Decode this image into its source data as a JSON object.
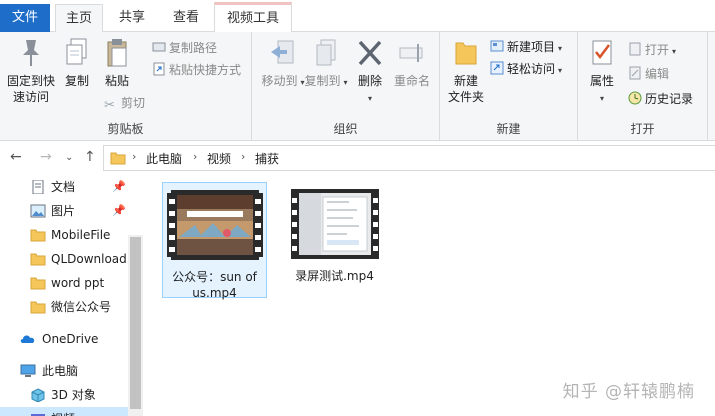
{
  "tabs": {
    "file": "文件",
    "home": "主页",
    "share": "共享",
    "view": "查看",
    "video_tools": "视频工具"
  },
  "ribbon": {
    "clipboard": {
      "label": "剪贴板",
      "pin_quick_access_1": "固定到快",
      "pin_quick_access_2": "速访问",
      "copy": "复制",
      "paste": "粘贴",
      "copy_path": "复制路径",
      "paste_shortcut": "粘贴快捷方式",
      "cut": "剪切"
    },
    "organize": {
      "label": "组织",
      "move_to": "移动到",
      "copy_to": "复制到",
      "delete": "删除",
      "rename": "重命名"
    },
    "new": {
      "label": "新建",
      "new_folder_1": "新建",
      "new_folder_2": "文件夹",
      "new_item": "新建项目",
      "easy_access": "轻松访问"
    },
    "open": {
      "label": "打开",
      "properties": "属性",
      "open": "打开",
      "edit": "编辑",
      "history": "历史记录"
    }
  },
  "breadcrumb": [
    "此电脑",
    "视频",
    "捕获"
  ],
  "sidebar": {
    "items": [
      {
        "label": "文档",
        "icon": "document-icon",
        "pinned": true
      },
      {
        "label": "图片",
        "icon": "picture-icon",
        "pinned": true
      },
      {
        "label": "MobileFile",
        "icon": "folder-icon"
      },
      {
        "label": "QLDownload",
        "icon": "folder-icon"
      },
      {
        "label": "word ppt",
        "icon": "folder-icon"
      },
      {
        "label": "微信公众号",
        "icon": "folder-icon"
      },
      {
        "label": "OneDrive",
        "icon": "cloud-icon"
      },
      {
        "label": "此电脑",
        "icon": "computer-icon"
      },
      {
        "label": "3D 对象",
        "icon": "cube-icon"
      },
      {
        "label": "视频",
        "icon": "video-folder-icon"
      }
    ],
    "pin_glyph": "📌"
  },
  "files": [
    {
      "name": "公众号：sun of us.mp4",
      "name_line1": "公众号：sun of",
      "name_line2": "us.mp4",
      "selected": true
    },
    {
      "name": "录屏测试.mp4",
      "name_line1": "录屏测试.mp4",
      "selected": false
    }
  ],
  "watermark": "知乎 @轩辕鹏楠",
  "colors": {
    "accent": "#1e6ec9",
    "selection": "#cce8ff",
    "ribbon_bg": "#f5f6f7"
  }
}
